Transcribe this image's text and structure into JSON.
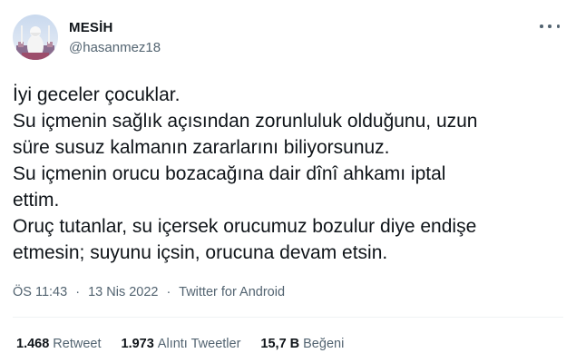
{
  "user": {
    "display_name": "MESİH",
    "handle": "@hasanmez18"
  },
  "tweet": {
    "lines": [
      "İyi geceler çocuklar.",
      "Su içmenin sağlık açısından zorunluluk olduğunu, uzun",
      "süre susuz kalmanın zararlarını biliyorsunuz.",
      "Su içmenin orucu bozacağına dair dînî ahkamı iptal",
      "ettim.",
      "Oruç tutanlar, su içersek orucumuz bozulur diye endişe",
      "etmesin; suyunu içsin, orucuna devam etsin."
    ]
  },
  "meta": {
    "time": "ÖS 11:43",
    "separator": "·",
    "date": "13 Nis 2022",
    "source": "Twitter for Android"
  },
  "stats": {
    "retweets_count": "1.468",
    "retweets_label": "Retweet",
    "quotes_count": "1.973",
    "quotes_label": "Alıntı Tweetler",
    "likes_count": "15,7 B",
    "likes_label": "Beğeni"
  },
  "icons": {
    "more": "more-options-icon",
    "avatar": "avatar-image"
  },
  "colors": {
    "text_primary": "#0f1419",
    "text_secondary": "#536471",
    "divider": "#eff3f4"
  }
}
